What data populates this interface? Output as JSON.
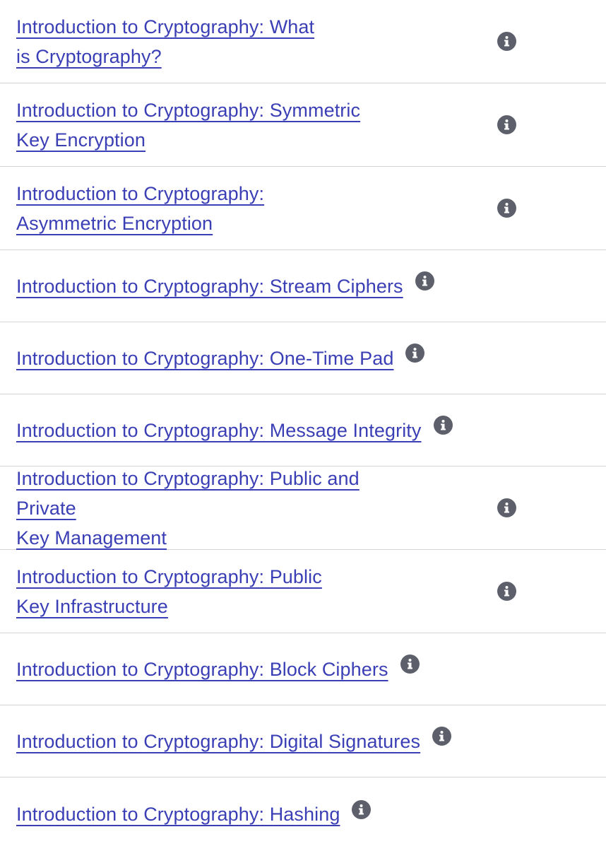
{
  "items": [
    {
      "label": "Introduction to Cryptography: What is Cryptography?",
      "line1": "Introduction to Cryptography: What",
      "line2": "is Cryptography?",
      "icon": "info-icon"
    },
    {
      "label": "Introduction to Cryptography: Symmetric Key Encryption",
      "line1": "Introduction to Cryptography: Symmetric",
      "line2": "Key Encryption",
      "icon": "info-icon"
    },
    {
      "label": "Introduction to Cryptography: Asymmetric Encryption",
      "line1": "Introduction to Cryptography:",
      "line2": "Asymmetric Encryption",
      "icon": "info-icon"
    },
    {
      "label": "Introduction to Cryptography: Stream Ciphers",
      "icon": "info-icon"
    },
    {
      "label": "Introduction to Cryptography: One-Time Pad",
      "icon": "info-icon"
    },
    {
      "label": "Introduction to Cryptography: Message Integrity",
      "icon": "info-icon"
    },
    {
      "label": "Introduction to Cryptography: Public and Private Key Management",
      "line1": "Introduction to Cryptography: Public and Private",
      "line2": "Key Management",
      "icon": "info-icon"
    },
    {
      "label": "Introduction to Cryptography: Public Key Infrastructure",
      "line1": "Introduction to Cryptography: Public",
      "line2": "Key Infrastructure",
      "icon": "info-icon"
    },
    {
      "label": "Introduction to Cryptography: Block Ciphers",
      "icon": "info-icon"
    },
    {
      "label": "Introduction to Cryptography: Digital Signatures",
      "icon": "info-icon"
    },
    {
      "label": "Introduction to Cryptography: Hashing",
      "icon": "info-icon"
    }
  ],
  "colors": {
    "link": "#3b3fb5",
    "icon": "#5d5f6b",
    "divider": "#d4d4d4"
  }
}
